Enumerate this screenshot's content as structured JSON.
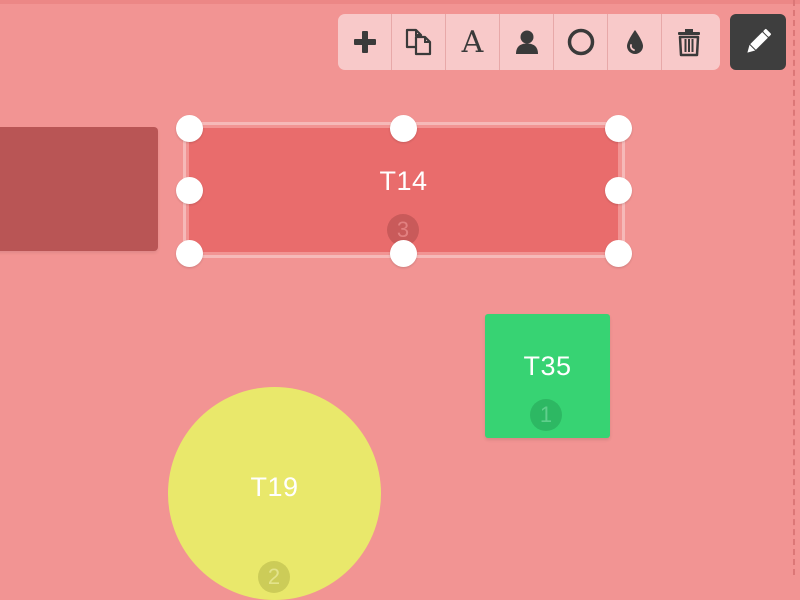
{
  "toolbar": {
    "items": [
      {
        "name": "add",
        "icon": "plus-icon"
      },
      {
        "name": "duplicate",
        "icon": "copy-icon"
      },
      {
        "name": "rename",
        "icon": "font-icon",
        "glyph": "A"
      },
      {
        "name": "seats",
        "icon": "user-icon"
      },
      {
        "name": "shape",
        "icon": "circle-icon"
      },
      {
        "name": "color",
        "icon": "drop-icon"
      },
      {
        "name": "delete",
        "icon": "trash-icon"
      }
    ],
    "edit_icon": "pencil-icon"
  },
  "tables": {
    "t14": {
      "name": "T14",
      "seats": "3",
      "shape": "rectangle",
      "color": "#e96c6c",
      "selected": true
    },
    "t35": {
      "name": "T35",
      "seats": "1",
      "shape": "square",
      "color": "#37d373"
    },
    "t19": {
      "name": "T19",
      "seats": "2",
      "shape": "circle",
      "color": "#e9e86b"
    },
    "left_partial": {
      "shape": "rectangle",
      "color": "#b95555"
    }
  },
  "colors": {
    "canvas_background": "#f29493",
    "toolbar_background": "#f8c9c9",
    "edit_button_background": "#3e3e3e"
  }
}
